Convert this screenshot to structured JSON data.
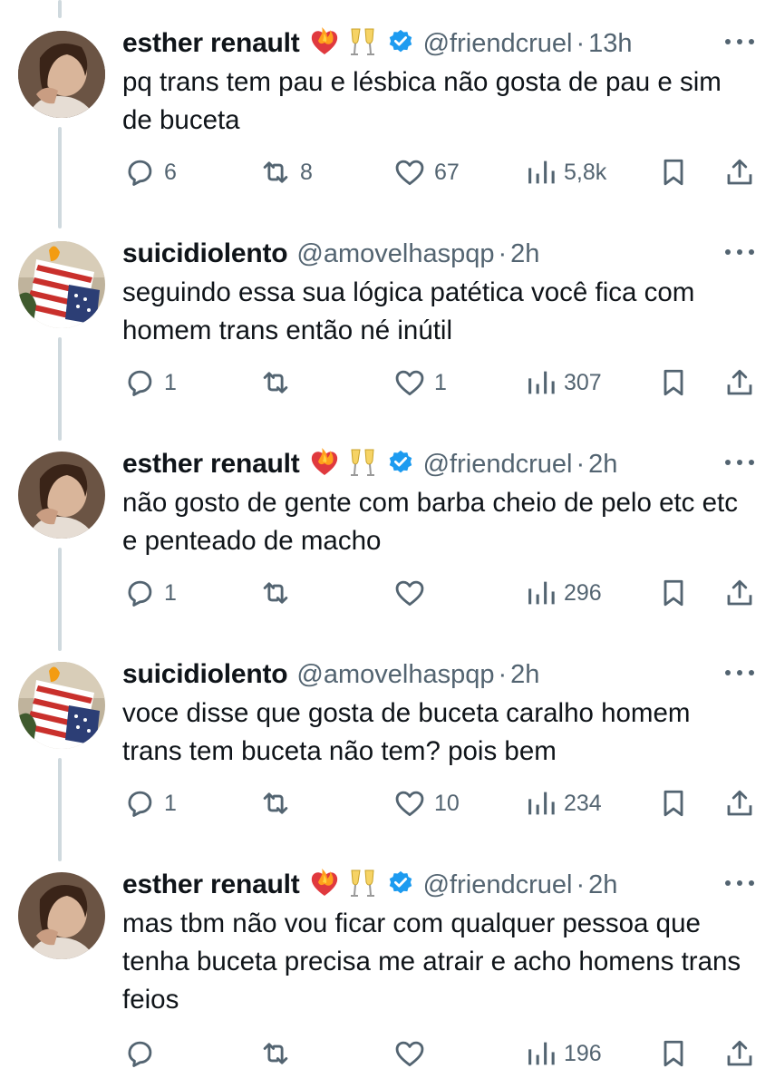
{
  "colors": {
    "text": "#0f1419",
    "secondary": "#536471",
    "verified": "#1d9bf0",
    "thread_line": "#cfd9de"
  },
  "tweets": [
    {
      "display_name": "esther renault",
      "emojis": [
        "heart-on-fire-emoji",
        "clinking-glasses-emoji"
      ],
      "verified": true,
      "handle": "@friendcruel",
      "time": "13h",
      "text": "pq trans tem pau e lésbica não gosta de pau e sim de buceta",
      "replies": "6",
      "retweets": "8",
      "likes": "67",
      "views": "5,8k"
    },
    {
      "display_name": "suicidiolento",
      "emojis": [],
      "verified": false,
      "handle": "@amovelhaspqp",
      "time": "2h",
      "text": "seguindo essa sua lógica patética você fica com homem trans então né inútil",
      "replies": "1",
      "retweets": "",
      "likes": "1",
      "views": "307"
    },
    {
      "display_name": "esther renault",
      "emojis": [
        "heart-on-fire-emoji",
        "clinking-glasses-emoji"
      ],
      "verified": true,
      "handle": "@friendcruel",
      "time": "2h",
      "text": "não gosto de gente com barba cheio de pelo etc etc e penteado de macho",
      "replies": "1",
      "retweets": "",
      "likes": "",
      "views": "296"
    },
    {
      "display_name": "suicidiolento",
      "emojis": [],
      "verified": false,
      "handle": "@amovelhaspqp",
      "time": "2h",
      "text": "voce disse que gosta de buceta caralho homem trans tem buceta não tem? pois bem",
      "replies": "1",
      "retweets": "",
      "likes": "10",
      "views": "234"
    },
    {
      "display_name": "esther renault",
      "emojis": [
        "heart-on-fire-emoji",
        "clinking-glasses-emoji"
      ],
      "verified": true,
      "handle": "@friendcruel",
      "time": "2h",
      "text": "mas tbm não vou ficar com qualquer pessoa que tenha buceta precisa me atrair e acho homens trans feios",
      "replies": "",
      "retweets": "",
      "likes": "",
      "views": "196"
    }
  ]
}
